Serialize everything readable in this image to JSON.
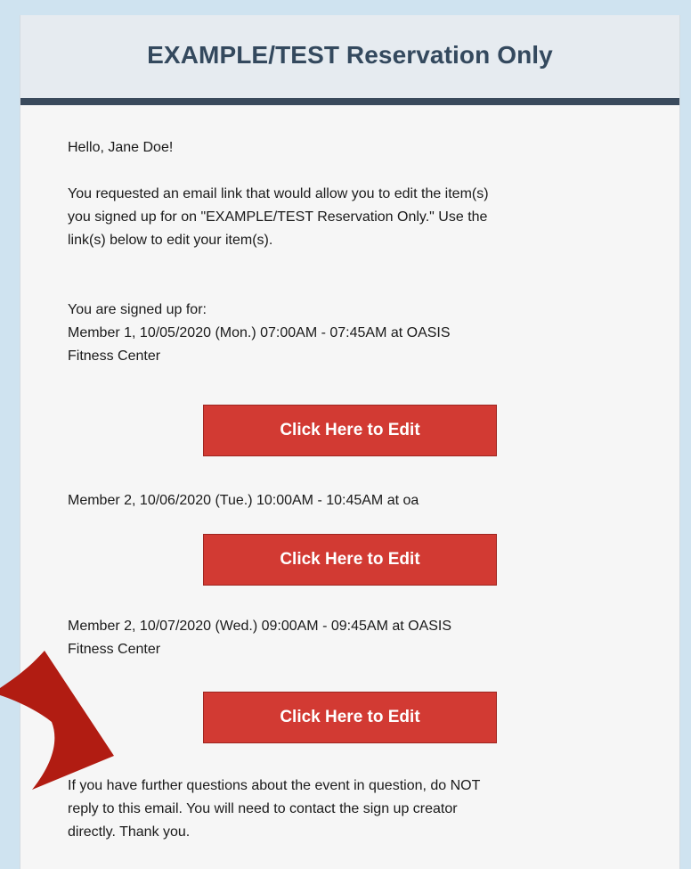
{
  "header": {
    "title": "EXAMPLE/TEST Reservation Only"
  },
  "email": {
    "greeting": "Hello, Jane Doe!",
    "intro_line_1": "You requested an email link that would allow you to edit the item(s)",
    "intro_line_2": "you signed up for on \"EXAMPLE/TEST Reservation Only.\" Use the",
    "intro_line_3": "link(s) below to edit your item(s).",
    "signed_up_label": "You are signed up for:",
    "items": [
      {
        "line_1": "Member 1, 10/05/2020 (Mon.) 07:00AM - 07:45AM at OASIS",
        "line_2": "Fitness Center",
        "button_label": "Click Here to Edit"
      },
      {
        "line_1": "Member 2, 10/06/2020 (Tue.) 10:00AM - 10:45AM at oa",
        "line_2": "",
        "button_label": "Click Here to Edit"
      },
      {
        "line_1": "Member 2, 10/07/2020 (Wed.) 09:00AM - 09:45AM at OASIS",
        "line_2": "Fitness Center",
        "button_label": "Click Here to Edit"
      }
    ],
    "closing_line_1": "If you have further questions about the event in question, do NOT",
    "closing_line_2": "reply to this email. You will need to contact the sign up creator",
    "closing_line_3": "directly. Thank you."
  },
  "colors": {
    "page_background": "#cfe3f0",
    "header_background": "#e6ebf0",
    "header_border": "#3a4a5c",
    "header_title": "#34495e",
    "button_background": "#d23a33",
    "arrow": "#b11c12"
  },
  "annotation": {
    "icon": "arrow-pointer-icon"
  }
}
